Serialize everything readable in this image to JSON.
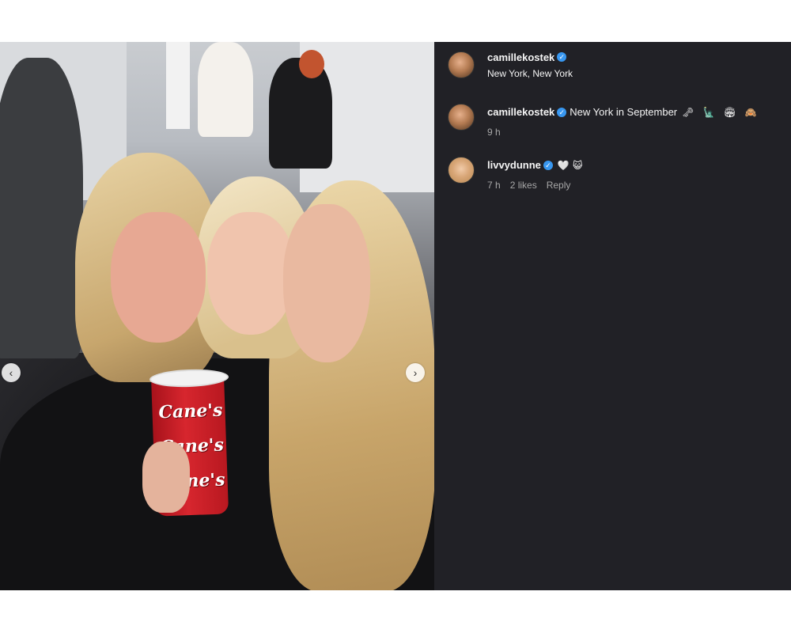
{
  "post": {
    "author": "camillekostek",
    "location": "New York, New York"
  },
  "photo": {
    "cup_label": "Cane's",
    "prev_icon": "chevron-left-icon",
    "next_icon": "chevron-right-icon",
    "prev_symbol": "‹",
    "next_symbol": "›"
  },
  "comments": [
    {
      "username": "camillekostek",
      "verified": true,
      "text": "New York in September",
      "emojis": "🗝 🗽 🏟 🙈",
      "time": "9 h"
    },
    {
      "username": "livvydunne",
      "verified": true,
      "text": "",
      "emojis": "🤍😺",
      "time": "7 h",
      "likes": "2 likes",
      "reply_label": "Reply"
    }
  ],
  "verified_symbol": "✓",
  "colors": {
    "panel_bg": "#212126",
    "verified": "#3897f0",
    "meta_text": "#a8a8a8"
  }
}
